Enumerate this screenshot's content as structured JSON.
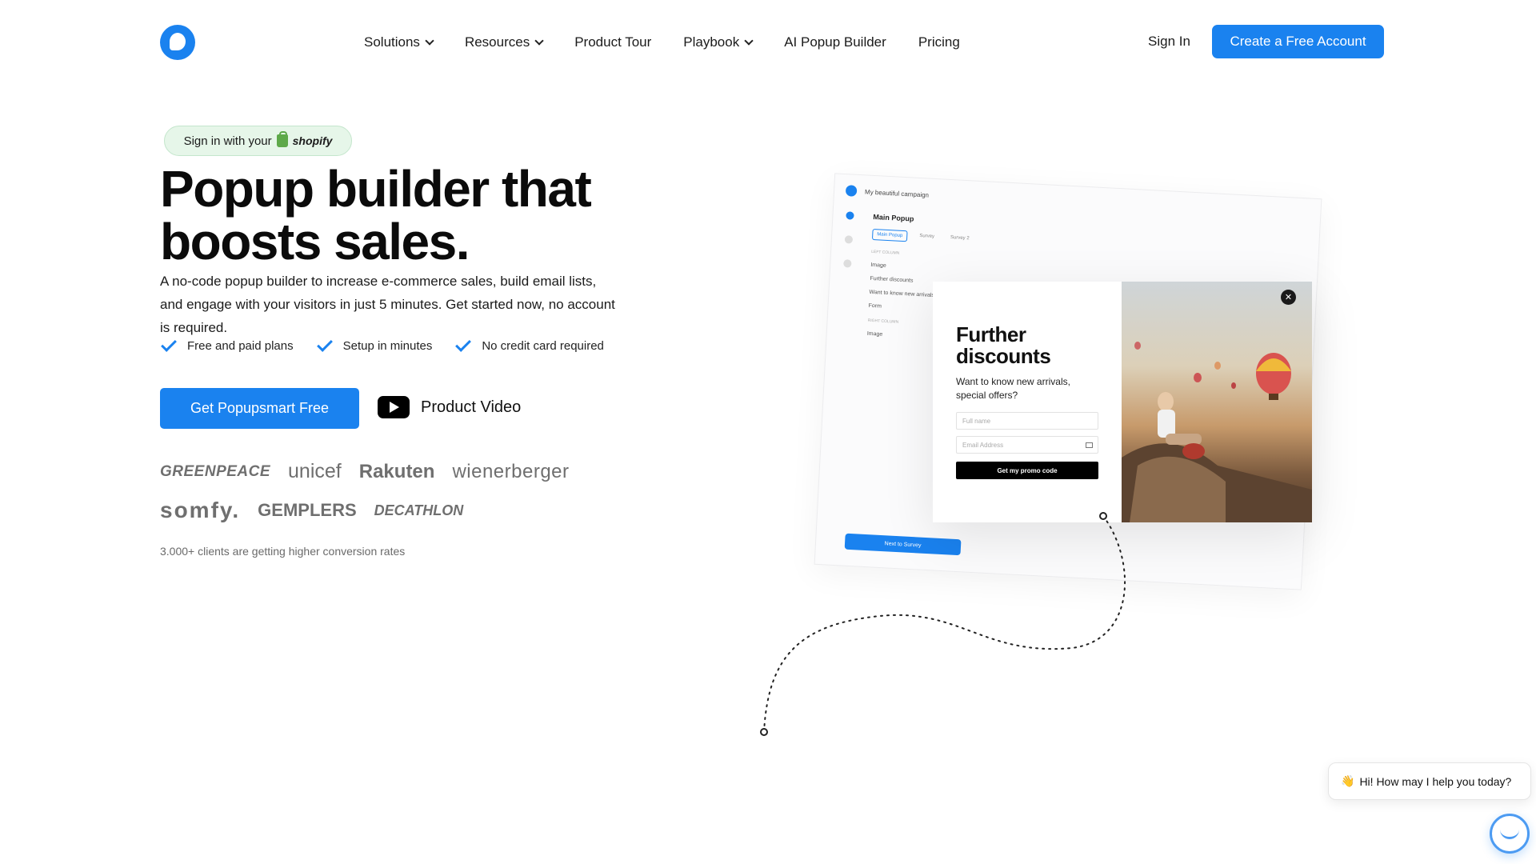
{
  "header": {
    "nav": [
      {
        "label": "Solutions",
        "dropdown": true
      },
      {
        "label": "Resources",
        "dropdown": true
      },
      {
        "label": "Product Tour",
        "dropdown": false
      },
      {
        "label": "Playbook",
        "dropdown": true
      },
      {
        "label": "AI Popup Builder",
        "dropdown": false
      },
      {
        "label": "Pricing",
        "dropdown": false
      }
    ],
    "sign_in": "Sign In",
    "create_account": "Create a Free Account"
  },
  "hero": {
    "shopify_prefix": "Sign in with your",
    "shopify_word": "shopify",
    "title_line1": "Popup builder that",
    "title_line2": "boosts sales.",
    "subtitle": "A no-code popup builder to increase e-commerce sales, build email lists, and engage with your visitors in just 5 minutes. Get started now, no account is required.",
    "checks": [
      "Free and paid plans",
      "Setup in minutes",
      "No credit card required"
    ],
    "cta": "Get Popupsmart Free",
    "video_label": "Product Video",
    "clients": [
      "GREENPEACE",
      "unicef",
      "Rakuten",
      "wienerberger",
      "somfy.",
      "GEMPLERS",
      "DECATHLON"
    ],
    "clients_note": "3.000+ clients are getting higher conversion rates"
  },
  "mockup": {
    "campaign": "My beautiful campaign",
    "panel_title": "Main Popup",
    "tabs": [
      "Main Popup",
      "Survey",
      "Survey 2"
    ],
    "section_left": "LEFT COLUMN",
    "rows": [
      "Image",
      "Further discounts",
      "Want to know new arrivals,",
      "Form"
    ],
    "section_right": "RIGHT COLUMN",
    "right_rows": [
      "Image"
    ],
    "next_button": "Next to Survey"
  },
  "popup": {
    "title": "Further discounts",
    "subtitle": "Want to know new arrivals, special offers?",
    "name_placeholder": "Full name",
    "email_placeholder": "Email Address",
    "cta": "Get my promo code"
  },
  "chat": {
    "message": "Hi! How may I help you today?",
    "emoji": "👋"
  },
  "colors": {
    "accent": "#1a82ef",
    "shopify_pill_bg": "#e6f6e9"
  }
}
